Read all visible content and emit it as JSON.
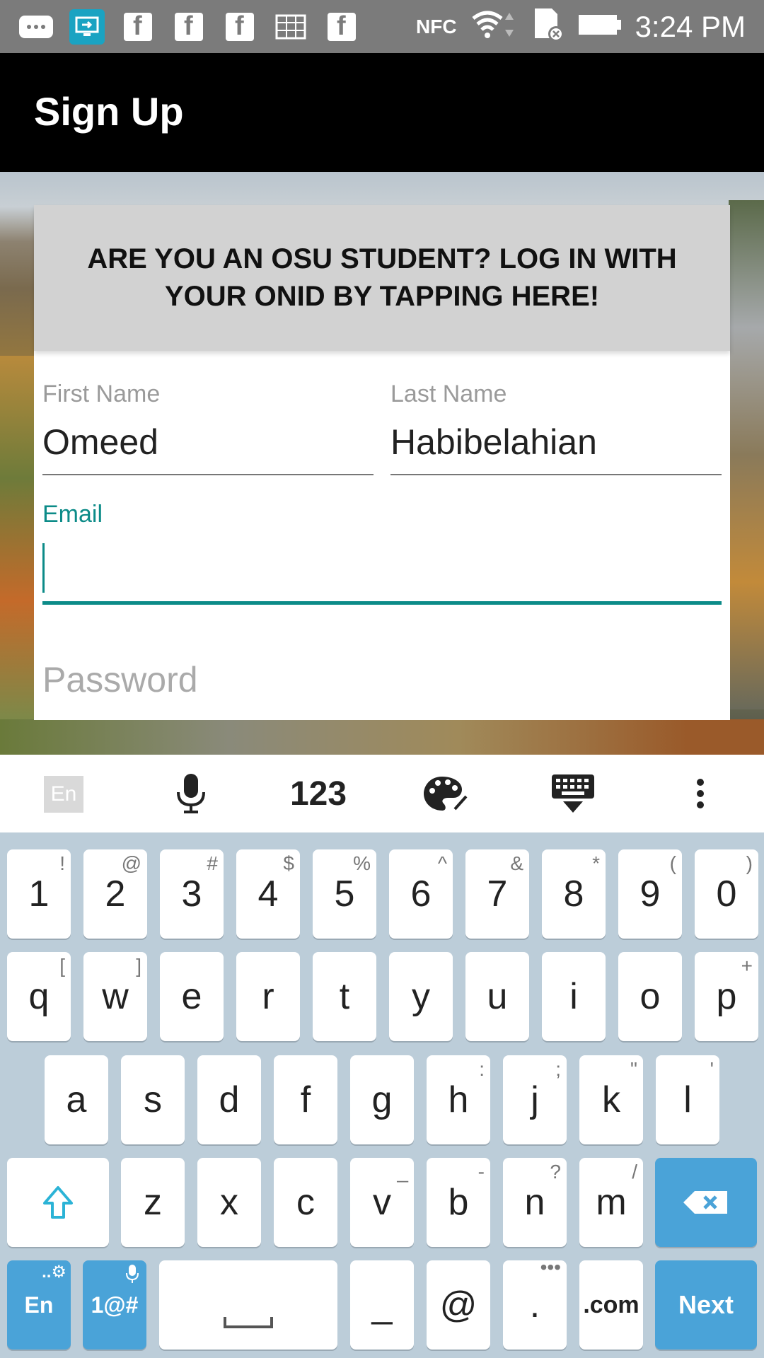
{
  "status_bar": {
    "time": "3:24 PM",
    "nfc_label": "NFC"
  },
  "appbar": {
    "title": "Sign Up"
  },
  "osu_banner": {
    "text": "ARE YOU AN OSU STUDENT? LOG IN WITH YOUR ONID BY TAPPING HERE!"
  },
  "form": {
    "first_name_label": "First Name",
    "first_name_value": "Omeed",
    "last_name_label": "Last Name",
    "last_name_value": "Habibelahian",
    "email_label": "Email",
    "email_value": "",
    "password_placeholder": "Password"
  },
  "keyboard_toolbar": {
    "lang_label": "En",
    "numbers_label": "123"
  },
  "keyboard": {
    "row1": [
      {
        "k": "1",
        "h": "!"
      },
      {
        "k": "2",
        "h": "@"
      },
      {
        "k": "3",
        "h": "#"
      },
      {
        "k": "4",
        "h": "$"
      },
      {
        "k": "5",
        "h": "%"
      },
      {
        "k": "6",
        "h": "^"
      },
      {
        "k": "7",
        "h": "&"
      },
      {
        "k": "8",
        "h": "*"
      },
      {
        "k": "9",
        "h": "("
      },
      {
        "k": "0",
        "h": ")"
      }
    ],
    "row2": [
      {
        "k": "q",
        "h": "["
      },
      {
        "k": "w",
        "h": "]"
      },
      {
        "k": "e",
        "h": ""
      },
      {
        "k": "r",
        "h": ""
      },
      {
        "k": "t",
        "h": ""
      },
      {
        "k": "y",
        "h": ""
      },
      {
        "k": "u",
        "h": ""
      },
      {
        "k": "i",
        "h": ""
      },
      {
        "k": "o",
        "h": ""
      },
      {
        "k": "p",
        "h": "+"
      }
    ],
    "row3": [
      {
        "k": "a",
        "h": ""
      },
      {
        "k": "s",
        "h": ""
      },
      {
        "k": "d",
        "h": ""
      },
      {
        "k": "f",
        "h": ""
      },
      {
        "k": "g",
        "h": ""
      },
      {
        "k": "h",
        "h": ":"
      },
      {
        "k": "j",
        "h": ";"
      },
      {
        "k": "k",
        "h": "\""
      },
      {
        "k": "l",
        "h": "'"
      }
    ],
    "row4": [
      {
        "k": "z",
        "h": ""
      },
      {
        "k": "x",
        "h": ""
      },
      {
        "k": "c",
        "h": ""
      },
      {
        "k": "v",
        "h": "_"
      },
      {
        "k": "b",
        "h": "-"
      },
      {
        "k": "n",
        "h": "?"
      },
      {
        "k": "m",
        "h": "/"
      }
    ],
    "lang_key": "En",
    "symbols_key": "1@#",
    "underscore_key": "_",
    "at_key": "@",
    "dot_key": ".",
    "dotcom_key": ".com",
    "next_key": "Next"
  }
}
